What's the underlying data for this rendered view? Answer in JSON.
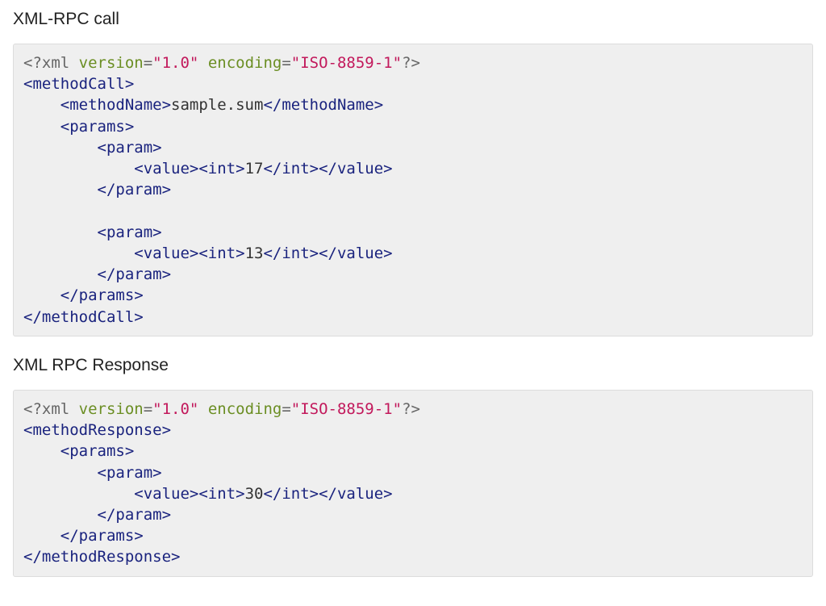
{
  "heading1": "XML-RPC call",
  "heading2": "XML RPC Response",
  "xml": {
    "decl_open": "<?xml ",
    "version_attr": "version",
    "eq": "=",
    "version_val": "\"1.0\"",
    "sp": " ",
    "encoding_attr": "encoding",
    "encoding_val": "\"ISO-8859-1\"",
    "decl_close": "?>"
  },
  "call": {
    "methodCall_open": "<methodCall>",
    "methodName_open": "<methodName>",
    "methodName_text": "sample.sum",
    "methodName_close": "</methodName>",
    "params_open": "<params>",
    "param_open": "<param>",
    "value_open": "<value>",
    "int_open": "<int>",
    "int1": "17",
    "int2": "13",
    "int_close": "</int>",
    "value_close": "</value>",
    "param_close": "</param>",
    "params_close": "</params>",
    "methodCall_close": "</methodCall>"
  },
  "response": {
    "methodResponse_open": "<methodResponse>",
    "params_open": "<params>",
    "param_open": "<param>",
    "value_open": "<value>",
    "int_open": "<int>",
    "int1": "30",
    "int_close": "</int>",
    "value_close": "</value>",
    "param_close": "</param>",
    "params_close": "</params>",
    "methodResponse_close": "</methodResponse>"
  },
  "indent1": "    ",
  "indent2": "        ",
  "indent3": "            "
}
